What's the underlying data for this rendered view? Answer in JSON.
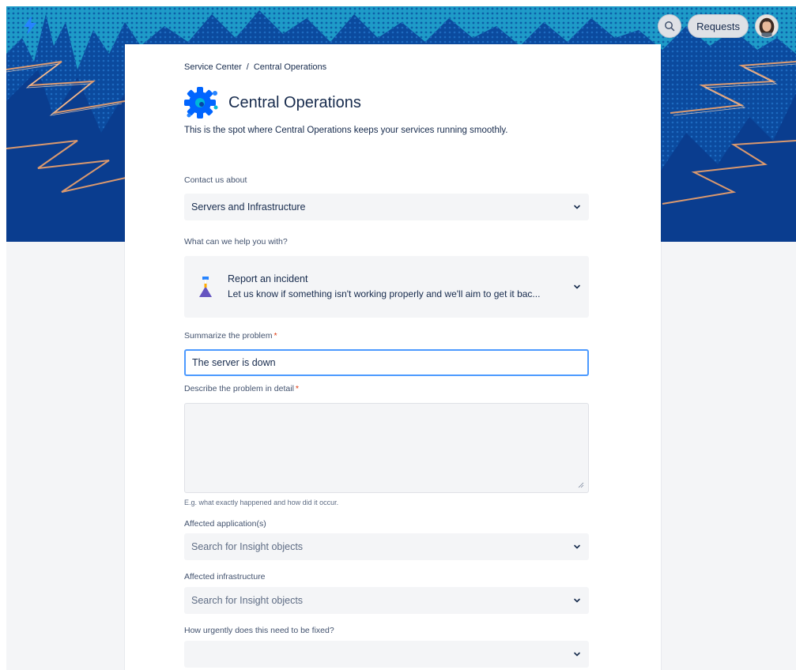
{
  "header": {
    "requests_label": "Requests"
  },
  "breadcrumb": {
    "root": "Service Center",
    "separator": "/",
    "current": "Central Operations"
  },
  "portal": {
    "title": "Central Operations",
    "description": "This is the spot where Central Operations keeps your services running smoothly."
  },
  "form": {
    "contact_about": {
      "label": "Contact us about",
      "value": "Servers and Infrastructure"
    },
    "request_type": {
      "label": "What can we help you with?",
      "name": "Report an incident",
      "description": "Let us know if something isn't working properly and we'll aim to get it bac..."
    },
    "summary": {
      "label": "Summarize the problem",
      "required_mark": "*",
      "value": "The server is down"
    },
    "details": {
      "label": "Describe the problem in detail",
      "required_mark": "*",
      "value": "",
      "help": "E.g. what exactly happened and how did it occur."
    },
    "affected_apps": {
      "label": "Affected application(s)",
      "placeholder": "Search for Insight objects"
    },
    "affected_infra": {
      "label": "Affected infrastructure",
      "placeholder": "Search for Insight objects"
    },
    "urgency": {
      "label": "How urgently does this need to be fixed?",
      "value": ""
    }
  },
  "icons": {
    "logo": "lightning-bolt-icon",
    "search": "search-icon",
    "avatar": "user-avatar",
    "portal_logo": "gear-icon",
    "request_type": "hourglass-icon",
    "dropdown": "chevron-down-icon"
  },
  "colors": {
    "banner_dark": "#0A3D8F",
    "banner_light": "#1E9BC8",
    "lightning": "#F2A36B",
    "focus_border": "#4C9AFF",
    "required": "#DE350B",
    "field_bg": "#F4F5F7"
  }
}
